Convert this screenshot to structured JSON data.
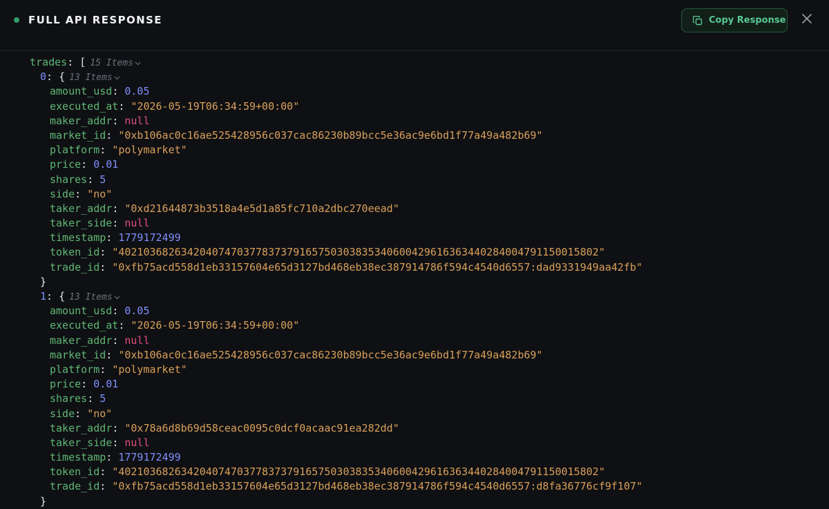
{
  "header": {
    "title": "FULL API RESPONSE",
    "copy_label": "Copy Response"
  },
  "colors": {
    "accent": "#58c892",
    "status_dot": "#2f9d6a",
    "string": "#d9a05b",
    "number": "#7f90ff",
    "null": "#e0507d",
    "key": "#5fb876"
  },
  "icons": {
    "copy": "copy-icon",
    "close": "close-icon",
    "chevron": "chevron-down-icon"
  },
  "response": {
    "root_key": "trades",
    "root_open": "[",
    "root_count": "15 Items",
    "items": [
      {
        "index": "0",
        "open": "{",
        "count": "13 Items",
        "close": "}",
        "fields": [
          {
            "key": "amount_usd",
            "value": "0.05",
            "type": "num"
          },
          {
            "key": "executed_at",
            "value": "\"2026-05-19T06:34:59+00:00\"",
            "type": "str"
          },
          {
            "key": "maker_addr",
            "value": "null",
            "type": "null"
          },
          {
            "key": "market_id",
            "value": "\"0xb106ac0c16ae525428956c037cac86230b89bcc5e36ac9e6bd1f77a49a482b69\"",
            "type": "str"
          },
          {
            "key": "platform",
            "value": "\"polymarket\"",
            "type": "str"
          },
          {
            "key": "price",
            "value": "0.01",
            "type": "num"
          },
          {
            "key": "shares",
            "value": "5",
            "type": "num"
          },
          {
            "key": "side",
            "value": "\"no\"",
            "type": "str"
          },
          {
            "key": "taker_addr",
            "value": "\"0xd21644873b3518a4e5d1a85fc710a2dbc270eead\"",
            "type": "str"
          },
          {
            "key": "taker_side",
            "value": "null",
            "type": "null"
          },
          {
            "key": "timestamp",
            "value": "1779172499",
            "type": "num"
          },
          {
            "key": "token_id",
            "value": "\"40210368263420407470377837379165750303835340600429616363440284004791150015802\"",
            "type": "str"
          },
          {
            "key": "trade_id",
            "value": "\"0xfb75acd558d1eb33157604e65d3127bd468eb38ec387914786f594c4540d6557:dad9331949aa42fb\"",
            "type": "str"
          }
        ]
      },
      {
        "index": "1",
        "open": "{",
        "count": "13 Items",
        "close": "}",
        "fields": [
          {
            "key": "amount_usd",
            "value": "0.05",
            "type": "num"
          },
          {
            "key": "executed_at",
            "value": "\"2026-05-19T06:34:59+00:00\"",
            "type": "str"
          },
          {
            "key": "maker_addr",
            "value": "null",
            "type": "null"
          },
          {
            "key": "market_id",
            "value": "\"0xb106ac0c16ae525428956c037cac86230b89bcc5e36ac9e6bd1f77a49a482b69\"",
            "type": "str"
          },
          {
            "key": "platform",
            "value": "\"polymarket\"",
            "type": "str"
          },
          {
            "key": "price",
            "value": "0.01",
            "type": "num"
          },
          {
            "key": "shares",
            "value": "5",
            "type": "num"
          },
          {
            "key": "side",
            "value": "\"no\"",
            "type": "str"
          },
          {
            "key": "taker_addr",
            "value": "\"0x78a6d8b69d58ceac0095c0dcf0acaac91ea282dd\"",
            "type": "str"
          },
          {
            "key": "taker_side",
            "value": "null",
            "type": "null"
          },
          {
            "key": "timestamp",
            "value": "1779172499",
            "type": "num"
          },
          {
            "key": "token_id",
            "value": "\"40210368263420407470377837379165750303835340600429616363440284004791150015802\"",
            "type": "str"
          },
          {
            "key": "trade_id",
            "value": "\"0xfb75acd558d1eb33157604e65d3127bd468eb38ec387914786f594c4540d6557:d8fa36776cf9f107\"",
            "type": "str"
          }
        ]
      }
    ]
  }
}
